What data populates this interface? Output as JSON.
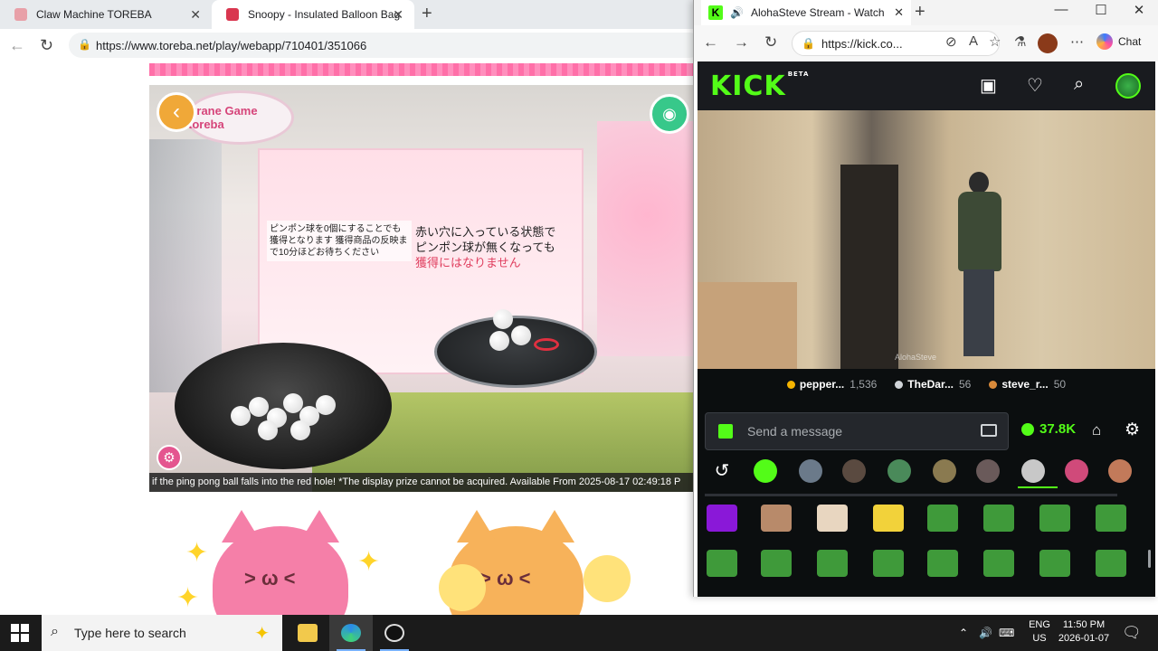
{
  "browser_main": {
    "tabs": [
      {
        "title": "Claw Machine TOREBA",
        "favicon_color": "#e8a0a8"
      },
      {
        "title": "Snoopy - Insulated Balloon Bag S",
        "favicon_color": "#d9364f"
      }
    ],
    "url": "https://www.toreba.net/play/webapp/710401/351066"
  },
  "game": {
    "logo_text": "Crane Game toreba",
    "notice_left": "ピンポン球を0個にすることでも獲得となります 獲得商品の反映まで10分ほどお待ちください",
    "notice_right_1": "赤い穴に入っている状態で",
    "notice_right_2": "ピンポン球が無くなっても",
    "notice_right_3": "獲得にはなりません",
    "ticker": "if the ping pong ball falls into the red hole! *The display prize cannot be acquired. Available From 2025-08-17 02:49:18 P"
  },
  "browser_kick": {
    "tab_title": "AlohaSteve Stream - Watch L",
    "url": "https://kick.co...",
    "chat_label": "Chat",
    "window_controls": {
      "minimize": "—",
      "maximize": "☐",
      "close": "✕"
    }
  },
  "kick": {
    "logo": "KICK",
    "logo_badge": "BETA",
    "watermark": "AlohaSteve",
    "leaders": [
      {
        "name": "pepper...",
        "count": "1,536",
        "color": "#f5b400"
      },
      {
        "name": "TheDar...",
        "count": "56",
        "color": "#d0d4d8"
      },
      {
        "name": "steve_r...",
        "count": "50",
        "color": "#d98a3a"
      }
    ],
    "message_placeholder": "Send a message",
    "kicks_count": "37.8K",
    "accent": "#53fc18"
  },
  "taskbar": {
    "search_placeholder": "Type here to search",
    "lang_1": "ENG",
    "lang_2": "US",
    "time": "11:50 PM",
    "date": "2026-01-07"
  }
}
